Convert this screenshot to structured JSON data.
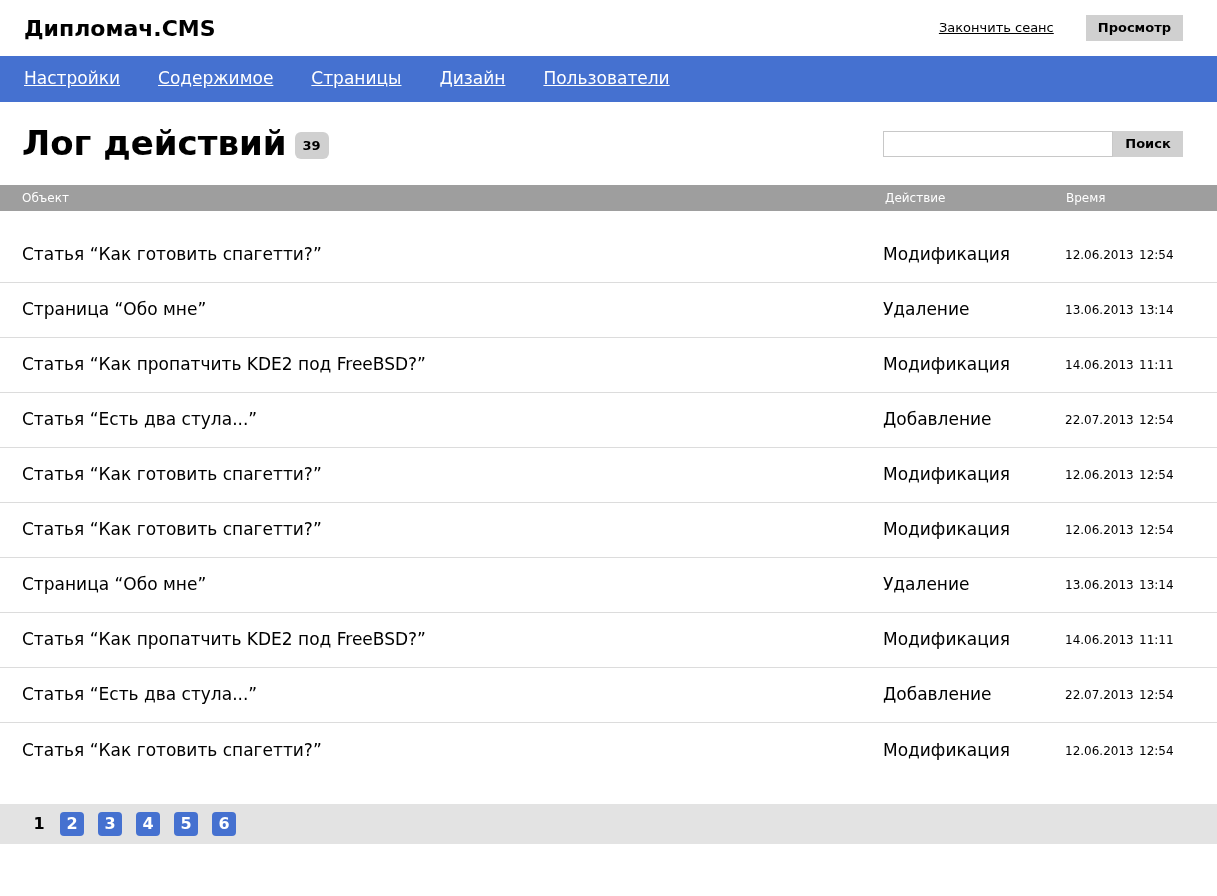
{
  "header": {
    "logo": "Дипломач.CMS",
    "logout_link": "Закончить сеанс",
    "preview_button": "Просмотр"
  },
  "nav": [
    "Настройки",
    "Содержимое",
    "Страницы",
    "Дизайн",
    "Пользователи"
  ],
  "page": {
    "title": "Лог действий",
    "count": "39",
    "search": {
      "button": "Поиск"
    }
  },
  "table": {
    "columns": [
      "Объект",
      "Действие",
      "Время"
    ],
    "rows": [
      {
        "object": "Статья “Как готовить спагетти?”",
        "action": "Модификация",
        "date": "12.06.2013",
        "time": "12:54"
      },
      {
        "object": "Страница “Обо мне”",
        "action": "Удаление",
        "date": "13.06.2013",
        "time": "13:14"
      },
      {
        "object": "Статья “Как пропатчить KDE2 под FreeBSD?”",
        "action": "Модификация",
        "date": "14.06.2013",
        "time": "11:11"
      },
      {
        "object": "Статья “Есть два стула...”",
        "action": "Добавление",
        "date": "22.07.2013",
        "time": "12:54"
      },
      {
        "object": "Статья “Как готовить спагетти?”",
        "action": "Модификация",
        "date": "12.06.2013",
        "time": "12:54"
      },
      {
        "object": "Статья “Как готовить спагетти?”",
        "action": "Модификация",
        "date": "12.06.2013",
        "time": "12:54"
      },
      {
        "object": "Страница “Обо мне”",
        "action": "Удаление",
        "date": "13.06.2013",
        "time": "13:14"
      },
      {
        "object": "Статья “Как пропатчить KDE2 под FreeBSD?”",
        "action": "Модификация",
        "date": "14.06.2013",
        "time": "11:11"
      },
      {
        "object": "Статья “Есть два стула...”",
        "action": "Добавление",
        "date": "22.07.2013",
        "time": "12:54"
      },
      {
        "object": "Статья “Как готовить спагетти?”",
        "action": "Модификация",
        "date": "12.06.2013",
        "time": "12:54"
      }
    ]
  },
  "pagination": [
    {
      "label": "1",
      "selected": true
    },
    {
      "label": "2",
      "selected": false
    },
    {
      "label": "3",
      "selected": false
    },
    {
      "label": "4",
      "selected": false
    },
    {
      "label": "5",
      "selected": false
    },
    {
      "label": "6",
      "selected": false
    }
  ]
}
